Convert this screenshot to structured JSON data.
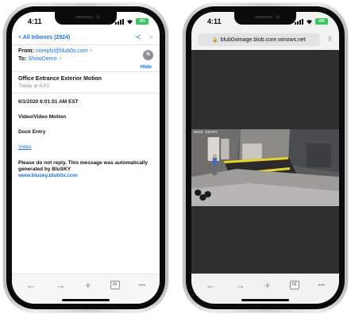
{
  "left_phone": {
    "status": {
      "time": "4:11",
      "battery": "ON"
    },
    "mail": {
      "back_label": "All Inboxes (2924)",
      "prev_arrow": "<",
      "next_arrow": ">",
      "from_label": "From:",
      "from_value": "noreply@blub0x.com",
      "to_label": "To:",
      "to_value": "ShowDemo",
      "caret": ">",
      "avatar_initial": "N",
      "hide_label": "Hide",
      "subject": "Office Entrance Exterior Motion",
      "received": "Today at 6:01",
      "body": {
        "timestamp": "6/1/2020 6:01:01 AM EST",
        "event_type": "Video/Video Motion",
        "location": "Dock Entry",
        "video_link": "Video",
        "disclaimer": "Please do not reply. This message was automatically generated by BluSKY",
        "website": "www.blusky.blub0x.com"
      }
    },
    "toolbar": {
      "back": "←",
      "forward": "→",
      "add": "+",
      "tabs": "56",
      "more": "•••"
    }
  },
  "right_phone": {
    "status": {
      "time": "4:11",
      "battery": "ON"
    },
    "browser": {
      "url": "blub0ximage.blob.core.winows.net",
      "lock_icon": "🔒",
      "share_icon": "⇪"
    },
    "camera": {
      "overlay_label": "DOCK ENTRY"
    },
    "toolbar": {
      "back": "←",
      "forward": "→",
      "add": "+",
      "tabs": "56",
      "more": "•••"
    }
  },
  "colors": {
    "link_blue": "#1a73e8",
    "battery_green": "#34c759",
    "browser_dark": "#2e2e2e"
  }
}
